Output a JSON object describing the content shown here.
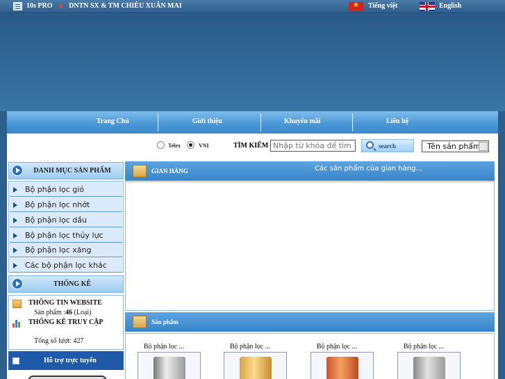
{
  "topbar": {
    "site_name": "10s PRO",
    "company": "DNTN SX & TM CHIÊU XUÂN MAI",
    "lang_vietnamese": "Tiếng việt",
    "lang_english": "English"
  },
  "nav": {
    "items": [
      "Trang Chủ",
      "Giới thiệu",
      "Khuyến mãi",
      "Liên hệ"
    ]
  },
  "search": {
    "telex_label": "Telex",
    "vni_label": "VNI",
    "label": "TÌM KIẾM",
    "placeholder": "Nhập từ khóa để tìm",
    "button_label": "search",
    "select_value": "Tên sản phẩm"
  },
  "categories": {
    "title": "DANH MỤC SẢN PHẨM",
    "items": [
      "Bộ phận lọc gió",
      "Bộ phận lọc nhớt",
      "Bộ phận lọc dầu",
      "Bộ phận lọc thủy lực",
      "Bộ phận lọc xăng",
      "Các bộ phận lọc khác"
    ]
  },
  "stats": {
    "title": "THỐNG KÊ",
    "website_info": "THÔNG TIN WEBSITE",
    "product_label": "Sản phẩm :",
    "product_count": "46",
    "product_unit": "(Loại)",
    "traffic_title": "THỐNG KÊ TRUY CẬP",
    "visits_label": "Tổng số lượt:",
    "visits_count": "427"
  },
  "support": {
    "title": "Hỗ trợ trực tuyến"
  },
  "shop": {
    "title": "GIAN HÀNG",
    "note": "Các sản phẩm của gian hàng..."
  },
  "products": {
    "title": "Sản phẩm",
    "items": [
      {
        "name": "Bộ phận lọc ..."
      },
      {
        "name": "Bộ phận lọc ..."
      },
      {
        "name": "Bộ phận lọc ..."
      },
      {
        "name": "Bộ phận lọc ..."
      }
    ]
  },
  "colors": {
    "banner": "#2d5f8c",
    "nav": "#4b98d7",
    "header_blue": "#3684c9",
    "support_blue": "#1f5aa8"
  }
}
